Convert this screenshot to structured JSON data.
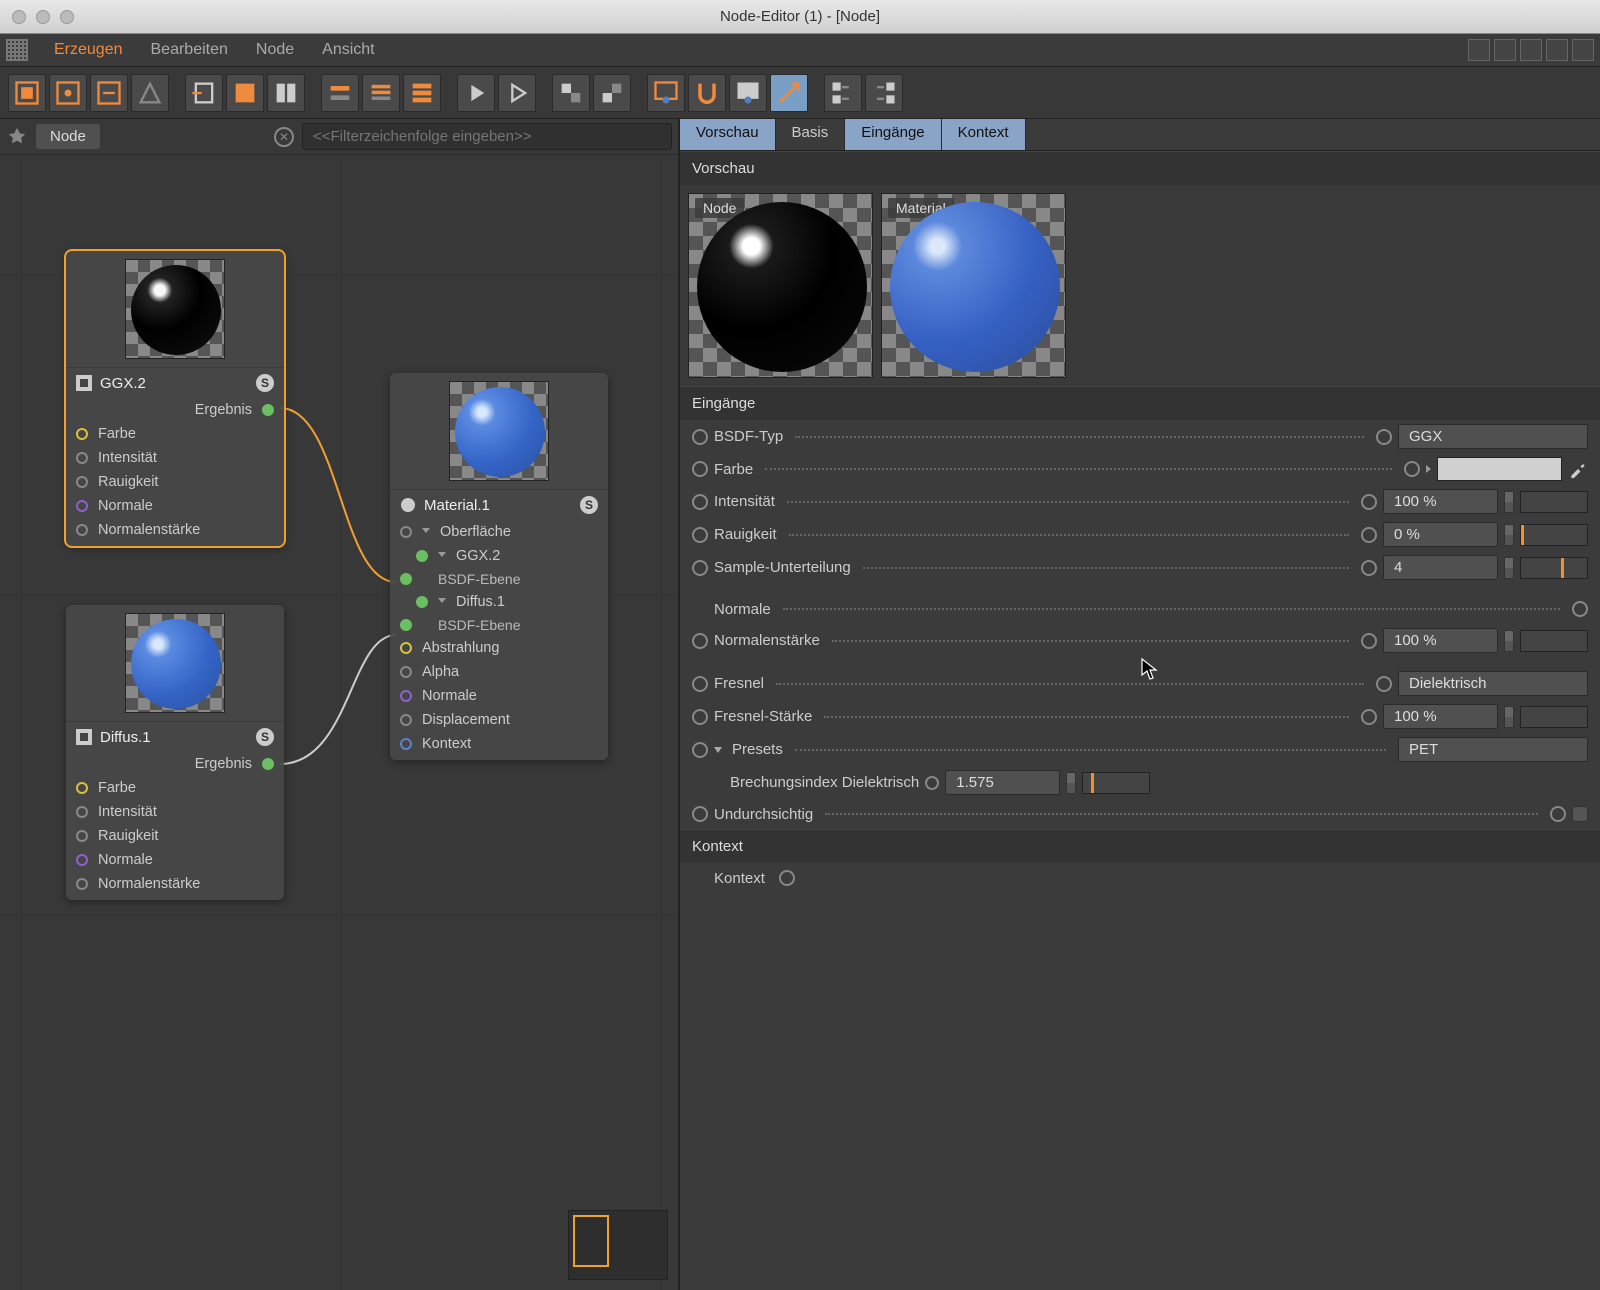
{
  "window": {
    "title": "Node-Editor (1) - [Node]"
  },
  "menubar": {
    "items": [
      "Erzeugen",
      "Bearbeiten",
      "Node",
      "Ansicht"
    ],
    "active_index": 0
  },
  "breadcrumb": {
    "node": "Node",
    "filter_placeholder": "<<Filterzeichenfolge eingeben>>"
  },
  "nodes": {
    "ggx": {
      "title": "GGX.2",
      "output": "Ergebnis",
      "inputs": [
        "Farbe",
        "Intensität",
        "Rauigkeit",
        "Normale",
        "Normalenstärke"
      ]
    },
    "diffus": {
      "title": "Diffus.1",
      "output": "Ergebnis",
      "inputs": [
        "Farbe",
        "Intensität",
        "Rauigkeit",
        "Normale",
        "Normalenstärke"
      ]
    },
    "material": {
      "title": "Material.1",
      "group_surface": "Oberfläche",
      "sub_ggx": "GGX.2",
      "sub_bsdf1": "BSDF-Ebene",
      "sub_diffus": "Diffus.1",
      "sub_bsdf2": "BSDF-Ebene",
      "inputs": [
        "Abstrahlung",
        "Alpha",
        "Normale",
        "Displacement",
        "Kontext"
      ]
    }
  },
  "tabs": {
    "items": [
      "Vorschau",
      "Basis",
      "Eingänge",
      "Kontext"
    ],
    "active": [
      0,
      2,
      3
    ]
  },
  "preview": {
    "heading": "Vorschau",
    "node_label": "Node",
    "material_label": "Material"
  },
  "inputs_section": {
    "heading": "Eingänge",
    "bsdf_type": {
      "label": "BSDF-Typ",
      "value": "GGX"
    },
    "farbe": {
      "label": "Farbe"
    },
    "intensitaet": {
      "label": "Intensität",
      "value": "100 %"
    },
    "rauigkeit": {
      "label": "Rauigkeit",
      "value": "0 %"
    },
    "sample": {
      "label": "Sample-Unterteilung",
      "value": "4"
    },
    "normale": {
      "label": "Normale"
    },
    "normalenstaerke": {
      "label": "Normalenstärke",
      "value": "100 %"
    },
    "fresnel": {
      "label": "Fresnel",
      "value": "Dielektrisch"
    },
    "fresnel_staerke": {
      "label": "Fresnel-Stärke",
      "value": "100 %"
    },
    "presets": {
      "label": "Presets",
      "value": "PET"
    },
    "brechung": {
      "label": "Brechungsindex Dielektrisch",
      "value": "1.575"
    },
    "undurchsichtig": {
      "label": "Undurchsichtig"
    }
  },
  "kontext_section": {
    "heading": "Kontext",
    "label": "Kontext"
  }
}
